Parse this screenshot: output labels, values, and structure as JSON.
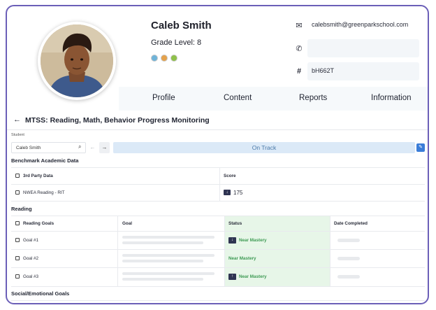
{
  "profile": {
    "name": "Caleb Smith",
    "grade_level": "Grade Level: 8",
    "email": "calebsmith@greenparkschool.com",
    "phone": "",
    "id_code": "bH662T",
    "badge_colors": [
      "#6fb4d9",
      "#e5a24c",
      "#8fc14a"
    ]
  },
  "tabs": [
    "Profile",
    "Content",
    "Reports",
    "Information"
  ],
  "mtss": {
    "title": "MTSS: Reading, Math, Behavior Progress Monitoring",
    "student_label": "Student",
    "student_value": "Caleb Smith",
    "status": "On Track"
  },
  "benchmark": {
    "title": "Benchmark Academic Data",
    "headers": [
      "3rd Party Data",
      "Score"
    ],
    "rows": [
      {
        "name": "NWEA Reading - RIT",
        "score": "175"
      }
    ]
  },
  "reading": {
    "title": "Reading",
    "headers": [
      "Reading Goals",
      "Goal",
      "Status",
      "Date Completed"
    ],
    "rows": [
      {
        "name": "Goal #1",
        "status": "Near Mastery",
        "arrow": "down"
      },
      {
        "name": "Goal #2",
        "status": "Near Mastery",
        "arrow": "none"
      },
      {
        "name": "Goal #3",
        "status": "Near Mastery",
        "arrow": "up"
      }
    ]
  },
  "social": {
    "title": "Social/Emotional Goals"
  }
}
